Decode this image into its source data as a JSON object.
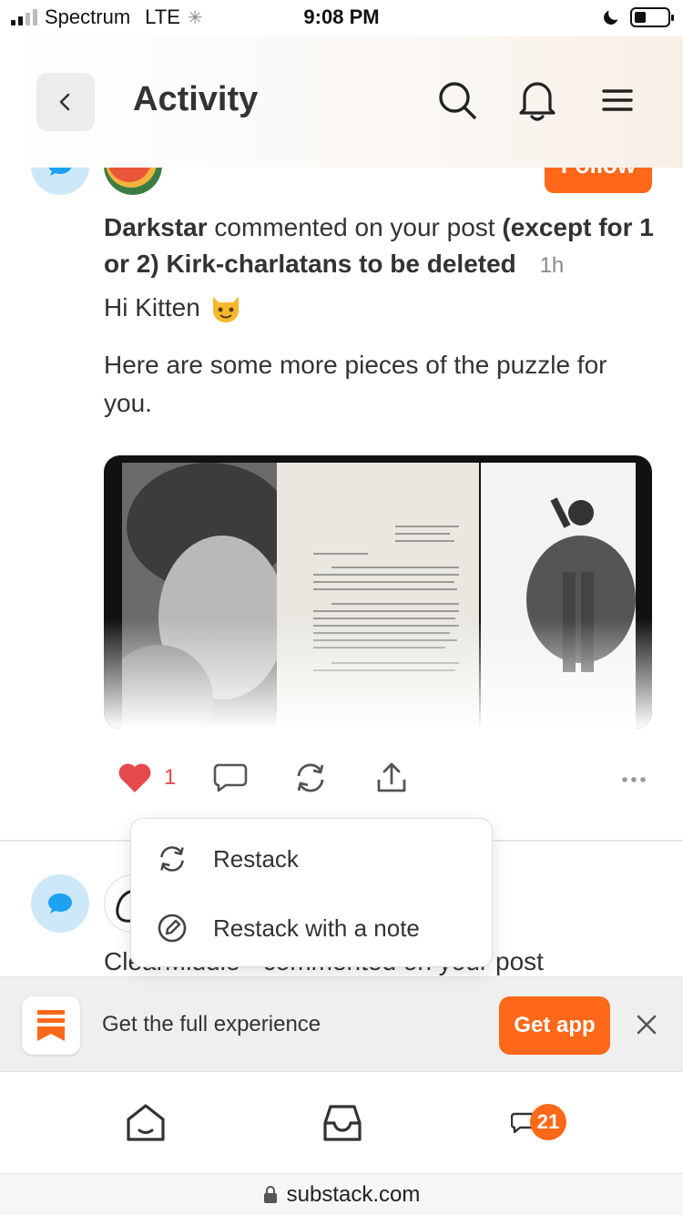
{
  "status_bar": {
    "carrier": "Spectrum",
    "network": "LTE",
    "time": "9:08 PM"
  },
  "header": {
    "title": "Activity",
    "icons": [
      "back-chevron-icon",
      "search-icon",
      "bell-icon",
      "menu-icon"
    ]
  },
  "feed": {
    "items": [
      {
        "follow_label": "Follow",
        "actor": "Darkstar",
        "action": "commented on your post",
        "post_title": "(except for 1 or 2) Kirk-charlatans to be deleted",
        "time_ago": "1h",
        "comment_greeting": "Hi Kitten",
        "comment_body": "Here are some more pieces of the puzzle for you.",
        "like_count": "1"
      },
      {
        "text_partial": "ClearMiddle • commented on your post"
      }
    ]
  },
  "restack_menu": {
    "items": [
      {
        "label": "Restack",
        "icon": "restack-icon"
      },
      {
        "label": "Restack with a note",
        "icon": "edit-icon"
      }
    ]
  },
  "banner": {
    "text": "Get the full experience",
    "button": "Get app"
  },
  "bottom_nav": {
    "items": [
      "home-icon",
      "inbox-icon",
      "chat-icon"
    ],
    "chat_badge": "21"
  },
  "url_bar": {
    "url": "substack.com"
  },
  "colors": {
    "accent": "#ff6719",
    "like": "#e5484d",
    "bubble_bg": "#cde9f9",
    "bubble_icon": "#1da1f2"
  }
}
